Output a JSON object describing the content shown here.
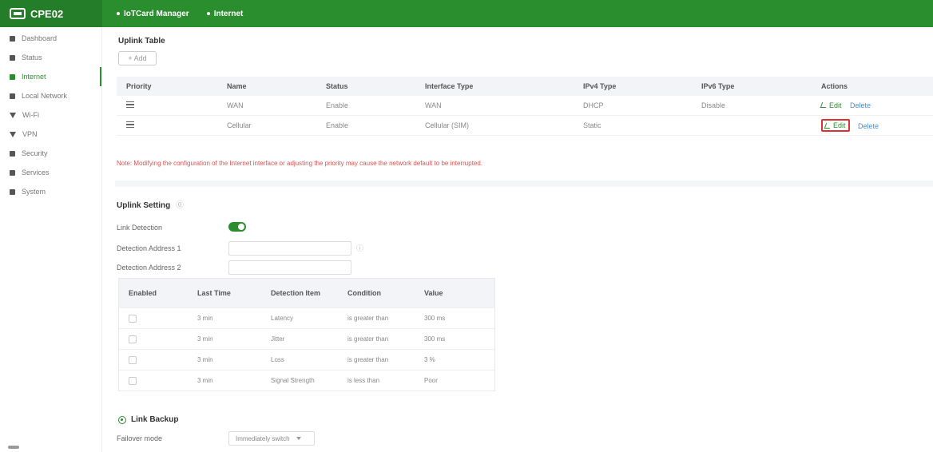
{
  "app": {
    "logo_text": "CPE02"
  },
  "breadcrumb": [
    "IoTCard Manager",
    "Internet"
  ],
  "sidebar": {
    "items": [
      {
        "label": "Dashboard",
        "icon": "dashboard-icon",
        "active": false
      },
      {
        "label": "Status",
        "icon": "status-icon",
        "active": false
      },
      {
        "label": "Internet",
        "icon": "internet-icon",
        "active": true
      },
      {
        "label": "Local Network",
        "icon": "local-network-icon",
        "active": false
      },
      {
        "label": "Wi-Fi",
        "icon": "wifi-icon",
        "active": false
      },
      {
        "label": "VPN",
        "icon": "vpn-icon",
        "active": false
      },
      {
        "label": "Security",
        "icon": "security-icon",
        "active": false
      },
      {
        "label": "Services",
        "icon": "services-icon",
        "active": false
      },
      {
        "label": "System",
        "icon": "system-icon",
        "active": false
      }
    ]
  },
  "uplink_table": {
    "title": "Uplink Table",
    "add_label": "+ Add",
    "headers": [
      "Priority",
      "Name",
      "Status",
      "Interface Type",
      "IPv4 Type",
      "IPv6 Type",
      "Actions"
    ],
    "rows": [
      {
        "name": "WAN",
        "status": "Enable",
        "interface_type": "WAN",
        "ipv4": "DHCP",
        "ipv6": "Disable",
        "edit": "Edit",
        "delete": "Delete"
      },
      {
        "name": "Cellular",
        "status": "Enable",
        "interface_type": "Cellular (SIM)",
        "ipv4": "Static",
        "ipv6": "",
        "edit": "Edit",
        "delete": "Delete"
      }
    ]
  },
  "note": "Note: Modifying the configuration of the Internet interface or adjusting the priority may cause the network default to be interrupted.",
  "uplink_setting": {
    "title": "Uplink Setting",
    "link_detection_label": "Link Detection",
    "link_detection_on": true,
    "address1_label": "Detection Address 1",
    "address2_label": "Detection Address 2",
    "address1_value": "",
    "address2_value": ""
  },
  "detection_table": {
    "headers": [
      "Enabled",
      "Last Time",
      "Detection Item",
      "Condition",
      "Value"
    ],
    "rows": [
      {
        "enabled": false,
        "last_time": "3 min",
        "item": "Latency",
        "condition": "is greater than",
        "value": "300 ms"
      },
      {
        "enabled": false,
        "last_time": "3 min",
        "item": "Jitter",
        "condition": "is greater than",
        "value": "300 ms"
      },
      {
        "enabled": false,
        "last_time": "3 min",
        "item": "Loss",
        "condition": "is greater than",
        "value": "3 %"
      },
      {
        "enabled": false,
        "last_time": "3 min",
        "item": "Signal Strength",
        "condition": "is less than",
        "value": "Poor"
      }
    ]
  },
  "link_backup": {
    "title": "Link Backup",
    "failover_label": "Failover mode",
    "failover_value": "Immediately switch"
  },
  "colors": {
    "brand": "#2a8d2e",
    "link": "#4a8fd8",
    "alert": "#d9534f"
  }
}
